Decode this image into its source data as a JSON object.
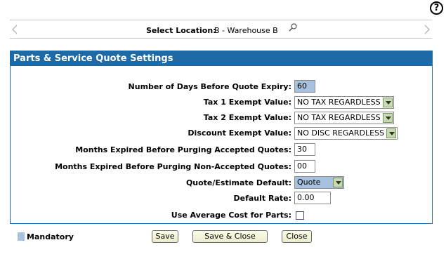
{
  "help": {
    "icon": "help-icon",
    "glyph": "?"
  },
  "location": {
    "label": "Select Location:",
    "value": "B - Warehouse B"
  },
  "panel": {
    "title": "Parts & Service Quote Settings",
    "fields": {
      "days_expiry": {
        "label": "Number of Days Before Quote Expiry:",
        "value": "60"
      },
      "tax1": {
        "label": "Tax 1 Exempt Value:",
        "value": "NO TAX REGARDLESS"
      },
      "tax2": {
        "label": "Tax 2 Exempt Value:",
        "value": "NO TAX REGARDLESS"
      },
      "discount": {
        "label": "Discount Exempt Value:",
        "value": "NO DISC REGARDLESS"
      },
      "purge_accepted": {
        "label": "Months Expired Before Purging Accepted Quotes:",
        "value": "30"
      },
      "purge_non_accepted": {
        "label": "Months Expired Before Purging Non-Accepted Quotes:",
        "value": "00"
      },
      "quote_default": {
        "label": "Quote/Estimate Default:",
        "value": "Quote"
      },
      "default_rate": {
        "label": "Default Rate:",
        "value": "0.00"
      },
      "avg_cost": {
        "label": "Use Average Cost for Parts:",
        "checked": false
      }
    }
  },
  "legend": {
    "mandatory_label": "Mandatory",
    "mandatory_color": "#a7c1de"
  },
  "buttons": {
    "save": "Save",
    "save_close": "Save & Close",
    "close": "Close"
  },
  "colors": {
    "accent": "#1e6aa6"
  }
}
